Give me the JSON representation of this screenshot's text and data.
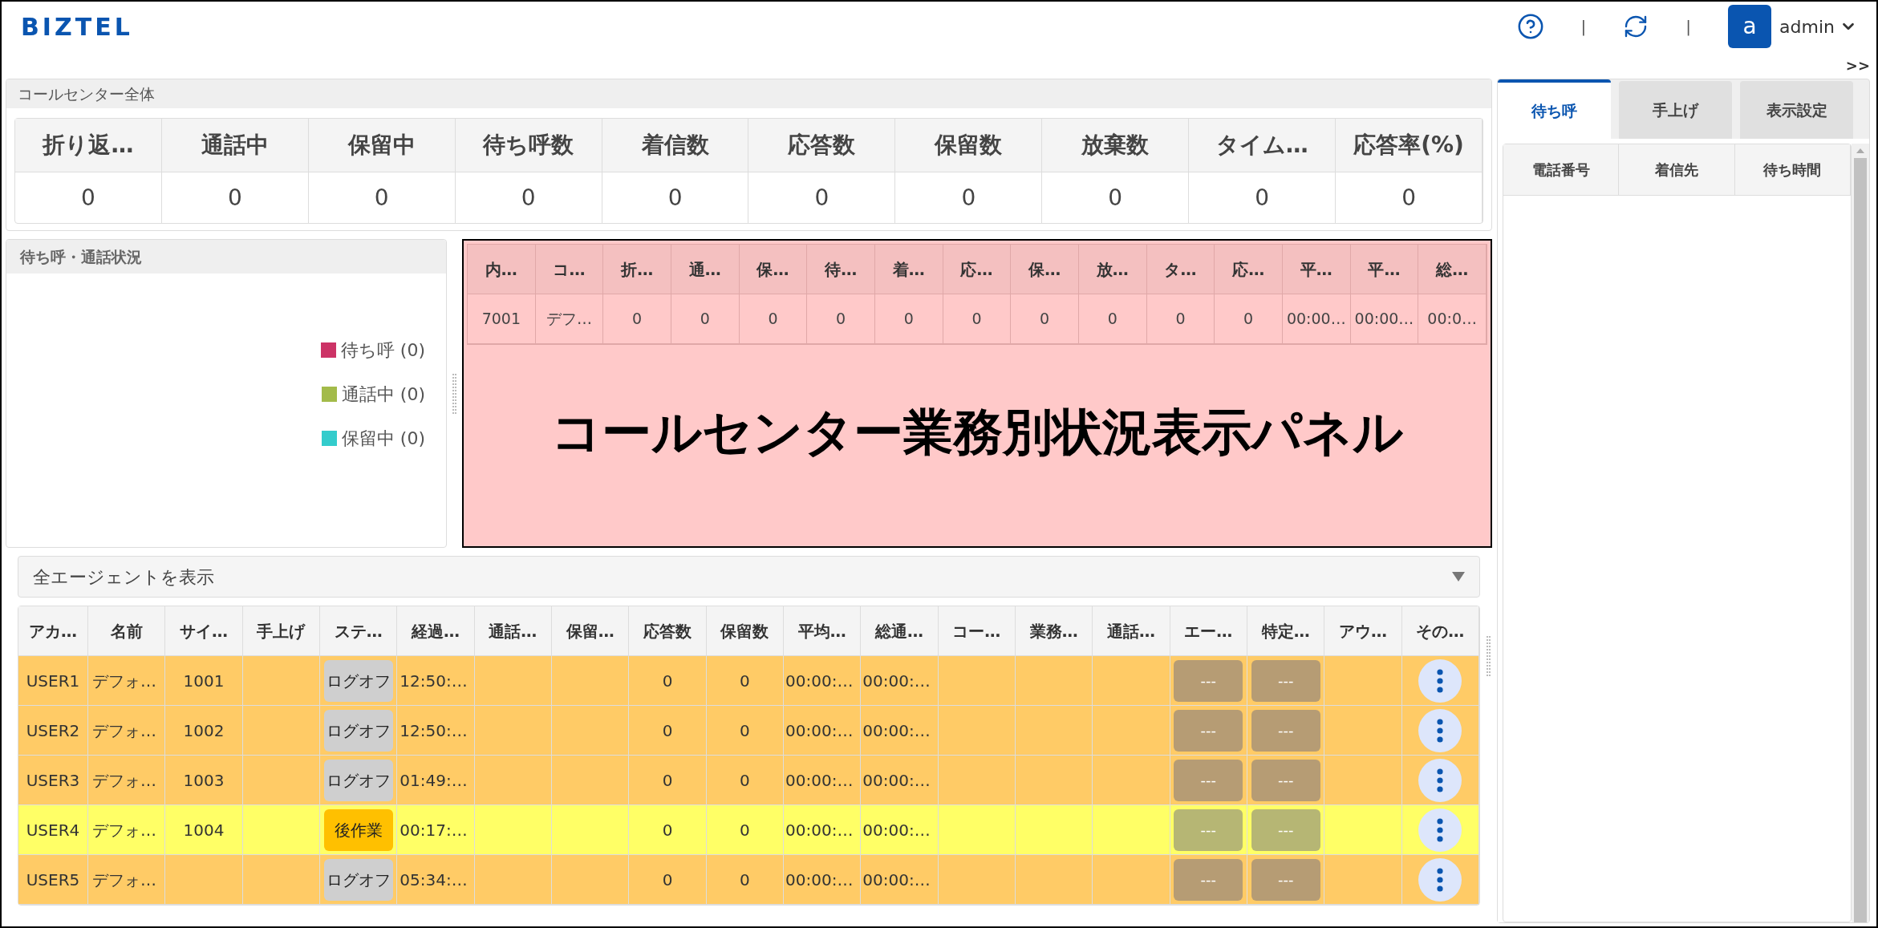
{
  "header": {
    "logo": "BIZTEL",
    "separators": [
      "|",
      "|"
    ],
    "avatar_letter": "a",
    "user": "admin"
  },
  "collapse_toggle": ">>",
  "overall": {
    "title": "コールセンター全体",
    "columns": [
      "折り返…",
      "通話中",
      "保留中",
      "待ち呼数",
      "着信数",
      "応答数",
      "保留数",
      "放棄数",
      "タイム…",
      "応答率(%)"
    ],
    "values": [
      "0",
      "0",
      "0",
      "0",
      "0",
      "0",
      "0",
      "0",
      "0",
      "0"
    ]
  },
  "queue_status": {
    "title": "待ち呼・通話状況",
    "legend": [
      {
        "label": "待ち呼 (0)",
        "color": "#cc3366"
      },
      {
        "label": "通話中 (0)",
        "color": "#a3bb4a"
      },
      {
        "label": "保留中 (0)",
        "color": "#33cccc"
      }
    ]
  },
  "task_panel": {
    "columns": [
      "内…",
      "コ…",
      "折…",
      "通…",
      "保…",
      "待…",
      "着…",
      "応…",
      "保…",
      "放…",
      "タ…",
      "応…",
      "平…",
      "平…",
      "総…"
    ],
    "rows": [
      [
        "7001",
        "デフ…",
        "0",
        "0",
        "0",
        "0",
        "0",
        "0",
        "0",
        "0",
        "0",
        "0",
        "00:00…",
        "00:00…",
        "00:0…"
      ]
    ],
    "overlay_label": "コールセンター業務別状況表示パネル"
  },
  "agents": {
    "filter": "全エージェントを表示",
    "columns": [
      "アカ…",
      "名前",
      "サイ…",
      "手上げ",
      "ステ…",
      "経過…",
      "通話…",
      "保留…",
      "応答数",
      "保留数",
      "平均…",
      "総通…",
      "コー…",
      "業務…",
      "通話…",
      "エー…",
      "特定…",
      "アウ…",
      "その…"
    ],
    "rows": [
      {
        "account": "USER1",
        "name": "デフォ…",
        "site": "1001",
        "status": {
          "text": "ログオフ",
          "kind": "logoff"
        },
        "elapsed": "12:50:…",
        "answered": "0",
        "held": "0",
        "average": "00:00:…",
        "total": "00:00:…",
        "buttons": [
          "---",
          "---"
        ]
      },
      {
        "account": "USER2",
        "name": "デフォ…",
        "site": "1002",
        "status": {
          "text": "ログオフ",
          "kind": "logoff"
        },
        "elapsed": "12:50:…",
        "answered": "0",
        "held": "0",
        "average": "00:00:…",
        "total": "00:00:…",
        "buttons": [
          "---",
          "---"
        ]
      },
      {
        "account": "USER3",
        "name": "デフォ…",
        "site": "1003",
        "status": {
          "text": "ログオフ",
          "kind": "logoff"
        },
        "elapsed": "01:49:…",
        "answered": "0",
        "held": "0",
        "average": "00:00:…",
        "total": "00:00:…",
        "buttons": [
          "---",
          "---"
        ]
      },
      {
        "account": "USER4",
        "name": "デフォ…",
        "site": "1004",
        "status": {
          "text": "後作業",
          "kind": "after_work"
        },
        "elapsed": "00:17:…",
        "answered": "0",
        "held": "0",
        "average": "00:00:…",
        "total": "00:00:…",
        "buttons": [
          "---",
          "---"
        ]
      },
      {
        "account": "USER5",
        "name": "デフォ…",
        "status": {
          "text": "ログオフ",
          "kind": "logoff"
        },
        "elapsed": "05:34:…",
        "answered": "0",
        "held": "0",
        "average": "00:00:…",
        "total": "00:00:…",
        "buttons": [
          "---",
          "---"
        ]
      }
    ]
  },
  "waiting_panel": {
    "tabs": [
      {
        "label": "待ち呼",
        "selected": true
      },
      {
        "label": "手上げ",
        "selected": false
      },
      {
        "label": "表示設定",
        "selected": false
      }
    ],
    "columns": [
      "電話番号",
      "着信先",
      "待ち時間"
    ]
  }
}
